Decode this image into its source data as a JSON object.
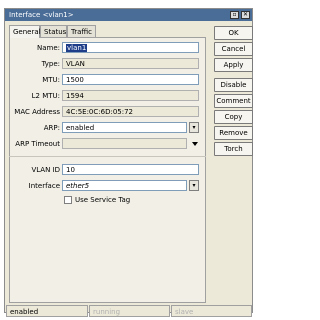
{
  "window": {
    "title": "Interface <vlan1>",
    "controls": [
      "restore-icon",
      "close-icon"
    ]
  },
  "tabs": [
    "General",
    "Status",
    "Traffic"
  ],
  "form": {
    "name_label": "Name:",
    "name_value": "vlan1",
    "type_label": "Type:",
    "type_value": "VLAN",
    "mtu_label": "MTU:",
    "mtu_value": "1500",
    "l2mtu_label": "L2 MTU:",
    "l2mtu_value": "1594",
    "mac_label": "MAC Address",
    "mac_value": "4C:5E:0C:6D:05:72",
    "arp_label": "ARP:",
    "arp_value": "enabled",
    "arp_timeout_label": "ARP Timeout",
    "arp_timeout_value": "",
    "vlan_id_label": "VLAN ID",
    "vlan_id_value": "10",
    "interface_label": "Interface",
    "interface_value": "ether5",
    "service_tag_label": "Use Service Tag",
    "service_tag_checked": false
  },
  "buttons": [
    "OK",
    "Cancel",
    "Apply",
    "Disable",
    "Comment",
    "Copy",
    "Remove",
    "Torch"
  ],
  "status": [
    "enabled",
    "running",
    "slave"
  ]
}
